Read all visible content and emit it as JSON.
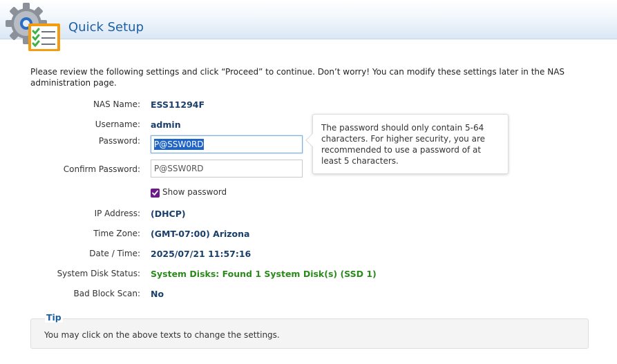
{
  "header": {
    "title": "Quick Setup",
    "icon": "settings-checklist-icon"
  },
  "intro": "Please review the following settings and click “Proceed” to continue. Don’t worry! You can modify these settings later in the NAS administration page.",
  "fields": {
    "nas_name": {
      "label": "NAS Name:",
      "value": "ESS11294F"
    },
    "username": {
      "label": "Username:",
      "value": "admin"
    },
    "password": {
      "label": "Password:",
      "value": "P@SSW0RD"
    },
    "confirm_password": {
      "label": "Confirm Password:",
      "value": "P@SSW0RD"
    },
    "show_password": {
      "label": "Show password",
      "checked": true
    },
    "ip_address": {
      "label": "IP Address:",
      "value": "(DHCP)"
    },
    "time_zone": {
      "label": "Time Zone:",
      "value": "(GMT-07:00) Arizona"
    },
    "date_time": {
      "label": "Date / Time:",
      "value": "2025/07/21 11:57:16"
    },
    "system_disk_status": {
      "label": "System Disk Status:",
      "value": "System Disks: Found 1 System Disk(s) (SSD 1)"
    },
    "bad_block_scan": {
      "label": "Bad Block Scan:",
      "value": "No"
    }
  },
  "tooltip": {
    "text": "The password should only contain 5-64 characters. For higher security, you are recommended to use a password of at least 5 characters."
  },
  "tip": {
    "title": "Tip",
    "text": "You may click on the above texts to change the settings."
  },
  "colors": {
    "title_blue": "#1d5fa5",
    "value_navy": "#1a3f6a",
    "status_green": "#2c8a1d",
    "checkbox_purple": "#6c1a8a",
    "selection_blue": "#1f64c8"
  }
}
